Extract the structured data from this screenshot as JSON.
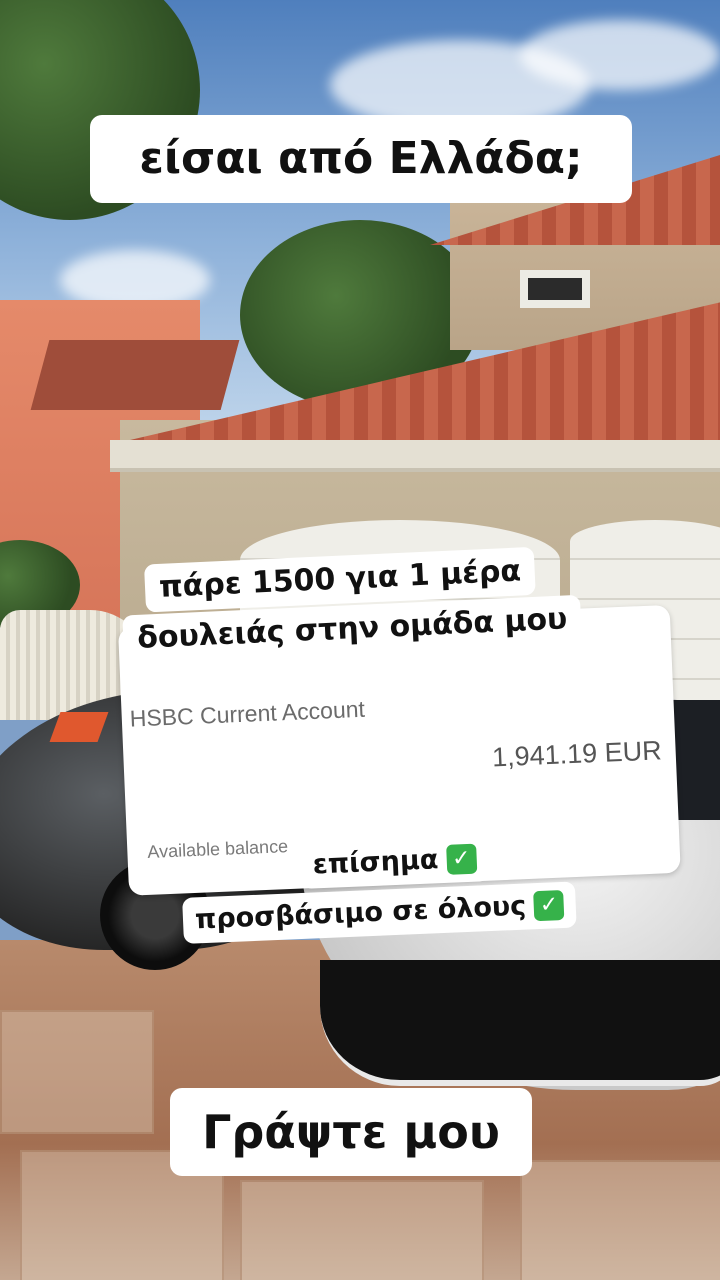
{
  "header": {
    "question": "είσαι από Ελλάδα;"
  },
  "offer": {
    "line1": "πάρε 1500 για 1 μέρα",
    "line2": "δουλειάς στην ομάδα μου"
  },
  "balance_card": {
    "account_name": "HSBC Current Account",
    "amount": "1,941.19 EUR",
    "available_label": "Available balance"
  },
  "badges": [
    {
      "text": "επίσημα",
      "icon": "check-mark-icon",
      "icon_glyph": "✓"
    },
    {
      "text": "προσβάσιμο σε όλους",
      "icon": "check-mark-icon",
      "icon_glyph": "✓"
    }
  ],
  "footer": {
    "cta": "Γράψτε μου"
  },
  "colors": {
    "check": "#36b24a",
    "caption_bg": "#ffffff",
    "text": "#111111"
  }
}
